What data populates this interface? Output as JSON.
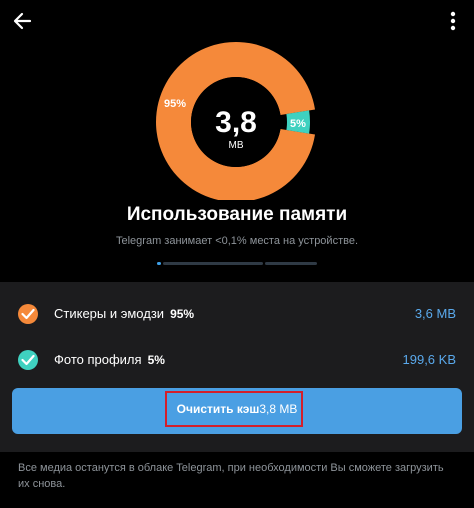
{
  "header": {
    "back_icon": "arrow-left-icon",
    "more_icon": "more-vertical-icon"
  },
  "storage_chart": {
    "center_value": "3,8",
    "center_unit": "MB",
    "label_large": "95%",
    "label_small": "5%",
    "colors": {
      "stickers": "#f5893a",
      "profile_photos": "#3fd1c0",
      "center": "#000000"
    }
  },
  "chart_data": {
    "type": "pie",
    "values": [
      95,
      5
    ],
    "labels": [
      "95%",
      "5%"
    ]
  },
  "title": "Использование памяти",
  "subtitle": "Telegram занимает <0,1% места на устройстве.",
  "items": [
    {
      "label": "Стикеры и эмодзи",
      "percent": "95%",
      "size": "3,6 MB",
      "color": "#f5893a",
      "icon": "check-icon"
    },
    {
      "label": "Фото профиля",
      "percent": "5%",
      "size": "199,6 KB",
      "color": "#3fd1c0",
      "icon": "check-icon"
    }
  ],
  "clear_button": {
    "label": "Очистить кэш",
    "size": "3,8 MB"
  },
  "footer": "Все медиа останутся в облаке Telegram, при необходимости Вы сможете загрузить их снова."
}
